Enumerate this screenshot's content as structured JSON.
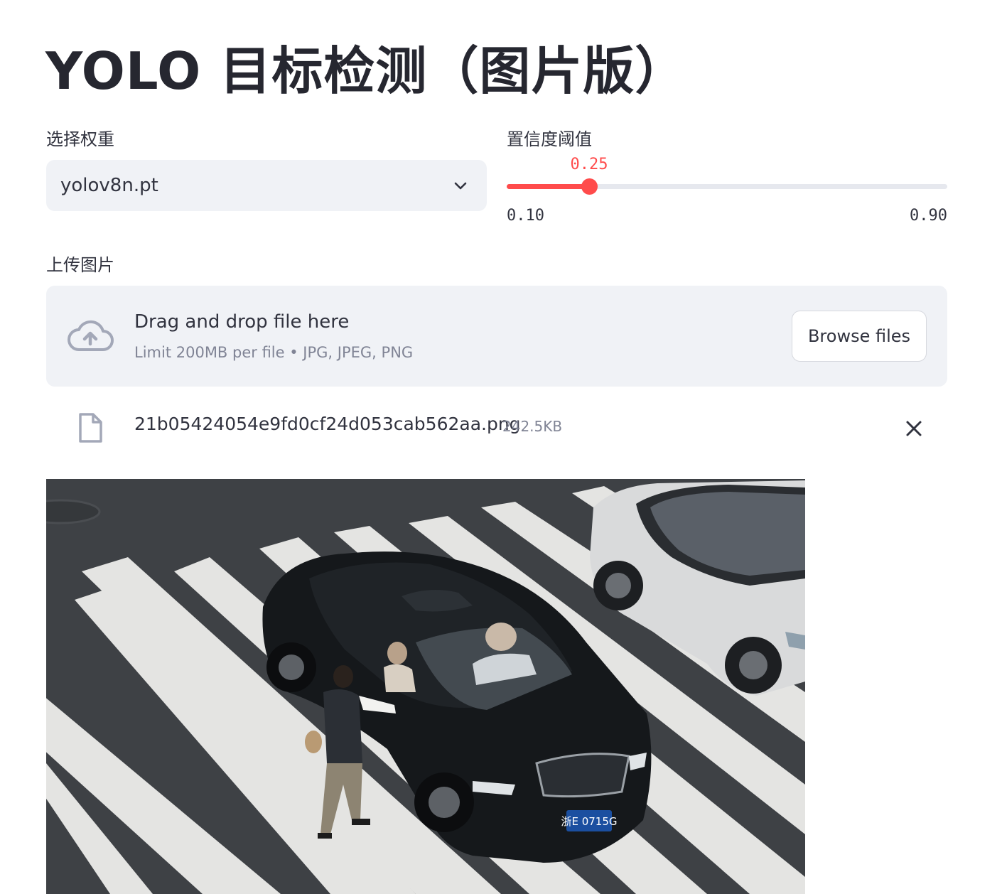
{
  "page": {
    "title": "YOLO 目标检测（图片版）"
  },
  "weights": {
    "label": "选择权重",
    "selected": "yolov8n.pt"
  },
  "confidence": {
    "label": "置信度阈值",
    "value": "0.25",
    "min": "0.10",
    "max": "0.90",
    "fraction": 0.1875
  },
  "upload": {
    "label": "上传图片",
    "drop_text": "Drag and drop file here",
    "limit_text": "Limit 200MB per file • JPG, JPEG, PNG",
    "browse_label": "Browse files",
    "file": {
      "name": "21b05424054e9fd0cf24d053cab562aa.png",
      "size": "242.5KB"
    }
  },
  "preview": {
    "plate_text": "浙E 0715G",
    "description_icon": "uploaded-photo"
  },
  "colors": {
    "accent": "#ff4b4b",
    "panel": "#f0f2f6",
    "text": "#31333f"
  }
}
